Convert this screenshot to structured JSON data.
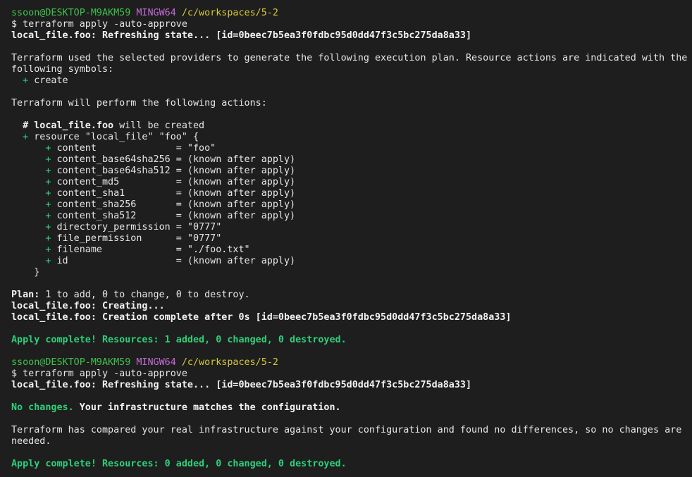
{
  "colors": {
    "background": "#1e1e1e",
    "text": "#e6e6e6",
    "prompt_user": "#3fc24d",
    "prompt_host": "#c46bd6",
    "prompt_path": "#d6c93a",
    "success_green": "#2fcf79"
  },
  "lines": [
    {
      "name": "prompt-line",
      "segments": [
        {
          "text": "ssoon@DESKTOP-M9AKM59",
          "cls": "c-prompt-user"
        },
        {
          "text": " ",
          "cls": ""
        },
        {
          "text": "MINGW64",
          "cls": "c-prompt-host"
        },
        {
          "text": " ",
          "cls": ""
        },
        {
          "text": "/c/workspaces/5-2",
          "cls": "c-prompt-path"
        }
      ]
    },
    {
      "name": "command-line",
      "segments": [
        {
          "text": "$ terraform apply -auto-approve",
          "cls": ""
        }
      ]
    },
    {
      "name": "refresh-line",
      "segments": [
        {
          "text": "local_file.foo: Refreshing state... [id=0beec7b5ea3f0fdbc95d0dd47f3c5bc275da8a33]",
          "cls": "bold c-white"
        }
      ]
    },
    {
      "name": "blank-line",
      "segments": []
    },
    {
      "name": "output-line",
      "segments": [
        {
          "text": "Terraform used the selected providers to generate the following execution plan. Resource actions are indicated with the",
          "cls": ""
        }
      ]
    },
    {
      "name": "output-line",
      "segments": [
        {
          "text": "following symbols:",
          "cls": ""
        }
      ]
    },
    {
      "name": "output-line",
      "segments": [
        {
          "text": "  ",
          "cls": ""
        },
        {
          "text": "+",
          "cls": "c-plus"
        },
        {
          "text": " create",
          "cls": ""
        }
      ]
    },
    {
      "name": "blank-line",
      "segments": []
    },
    {
      "name": "output-line",
      "segments": [
        {
          "text": "Terraform will perform the following actions:",
          "cls": ""
        }
      ]
    },
    {
      "name": "blank-line",
      "segments": []
    },
    {
      "name": "output-line",
      "segments": [
        {
          "text": "  # local_file.foo",
          "cls": "bold c-white"
        },
        {
          "text": " will be created",
          "cls": ""
        }
      ]
    },
    {
      "name": "output-line",
      "segments": [
        {
          "text": "  ",
          "cls": ""
        },
        {
          "text": "+",
          "cls": "c-plus"
        },
        {
          "text": " resource \"local_file\" \"foo\" {",
          "cls": ""
        }
      ]
    },
    {
      "name": "attribute-line",
      "segments": [
        {
          "text": "      ",
          "cls": ""
        },
        {
          "text": "+",
          "cls": "c-plus"
        },
        {
          "text": " content              = \"foo\"",
          "cls": ""
        }
      ]
    },
    {
      "name": "attribute-line",
      "segments": [
        {
          "text": "      ",
          "cls": ""
        },
        {
          "text": "+",
          "cls": "c-plus"
        },
        {
          "text": " content_base64sha256 = (known after apply)",
          "cls": ""
        }
      ]
    },
    {
      "name": "attribute-line",
      "segments": [
        {
          "text": "      ",
          "cls": ""
        },
        {
          "text": "+",
          "cls": "c-plus"
        },
        {
          "text": " content_base64sha512 = (known after apply)",
          "cls": ""
        }
      ]
    },
    {
      "name": "attribute-line",
      "segments": [
        {
          "text": "      ",
          "cls": ""
        },
        {
          "text": "+",
          "cls": "c-plus"
        },
        {
          "text": " content_md5          = (known after apply)",
          "cls": ""
        }
      ]
    },
    {
      "name": "attribute-line",
      "segments": [
        {
          "text": "      ",
          "cls": ""
        },
        {
          "text": "+",
          "cls": "c-plus"
        },
        {
          "text": " content_sha1         = (known after apply)",
          "cls": ""
        }
      ]
    },
    {
      "name": "attribute-line",
      "segments": [
        {
          "text": "      ",
          "cls": ""
        },
        {
          "text": "+",
          "cls": "c-plus"
        },
        {
          "text": " content_sha256       = (known after apply)",
          "cls": ""
        }
      ]
    },
    {
      "name": "attribute-line",
      "segments": [
        {
          "text": "      ",
          "cls": ""
        },
        {
          "text": "+",
          "cls": "c-plus"
        },
        {
          "text": " content_sha512       = (known after apply)",
          "cls": ""
        }
      ]
    },
    {
      "name": "attribute-line",
      "segments": [
        {
          "text": "      ",
          "cls": ""
        },
        {
          "text": "+",
          "cls": "c-plus"
        },
        {
          "text": " directory_permission = \"0777\"",
          "cls": ""
        }
      ]
    },
    {
      "name": "attribute-line",
      "segments": [
        {
          "text": "      ",
          "cls": ""
        },
        {
          "text": "+",
          "cls": "c-plus"
        },
        {
          "text": " file_permission      = \"0777\"",
          "cls": ""
        }
      ]
    },
    {
      "name": "attribute-line",
      "segments": [
        {
          "text": "      ",
          "cls": ""
        },
        {
          "text": "+",
          "cls": "c-plus"
        },
        {
          "text": " filename             = \"./foo.txt\"",
          "cls": ""
        }
      ]
    },
    {
      "name": "attribute-line",
      "segments": [
        {
          "text": "      ",
          "cls": ""
        },
        {
          "text": "+",
          "cls": "c-plus"
        },
        {
          "text": " id                   = (known after apply)",
          "cls": ""
        }
      ]
    },
    {
      "name": "output-line",
      "segments": [
        {
          "text": "    }",
          "cls": ""
        }
      ]
    },
    {
      "name": "blank-line",
      "segments": []
    },
    {
      "name": "plan-line",
      "segments": [
        {
          "text": "Plan:",
          "cls": "bold c-white"
        },
        {
          "text": " 1 to add, 0 to change, 0 to destroy.",
          "cls": ""
        }
      ]
    },
    {
      "name": "status-line",
      "segments": [
        {
          "text": "local_file.foo: Creating...",
          "cls": "bold c-white"
        }
      ]
    },
    {
      "name": "status-line",
      "segments": [
        {
          "text": "local_file.foo: Creation complete after 0s [id=0beec7b5ea3f0fdbc95d0dd47f3c5bc275da8a33]",
          "cls": "bold c-white"
        }
      ]
    },
    {
      "name": "blank-line",
      "segments": []
    },
    {
      "name": "apply-complete-line",
      "segments": [
        {
          "text": "Apply complete! Resources: 1 added, 0 changed, 0 destroyed.",
          "cls": "bold c-green"
        }
      ]
    },
    {
      "name": "blank-line",
      "segments": []
    },
    {
      "name": "prompt-line",
      "segments": [
        {
          "text": "ssoon@DESKTOP-M9AKM59",
          "cls": "c-prompt-user"
        },
        {
          "text": " ",
          "cls": ""
        },
        {
          "text": "MINGW64",
          "cls": "c-prompt-host"
        },
        {
          "text": " ",
          "cls": ""
        },
        {
          "text": "/c/workspaces/5-2",
          "cls": "c-prompt-path"
        }
      ]
    },
    {
      "name": "command-line",
      "segments": [
        {
          "text": "$ terraform apply -auto-approve",
          "cls": ""
        }
      ]
    },
    {
      "name": "refresh-line",
      "segments": [
        {
          "text": "local_file.foo: Refreshing state... [id=0beec7b5ea3f0fdbc95d0dd47f3c5bc275da8a33]",
          "cls": "bold c-white"
        }
      ]
    },
    {
      "name": "blank-line",
      "segments": []
    },
    {
      "name": "no-changes-line",
      "segments": [
        {
          "text": "No changes.",
          "cls": "bold c-green"
        },
        {
          "text": " Your infrastructure matches the configuration.",
          "cls": "bold c-white"
        }
      ]
    },
    {
      "name": "blank-line",
      "segments": []
    },
    {
      "name": "output-line",
      "segments": [
        {
          "text": "Terraform has compared your real infrastructure against your configuration and found no differences, so no changes are",
          "cls": ""
        }
      ]
    },
    {
      "name": "output-line",
      "segments": [
        {
          "text": "needed.",
          "cls": ""
        }
      ]
    },
    {
      "name": "blank-line",
      "segments": []
    },
    {
      "name": "apply-complete-line",
      "segments": [
        {
          "text": "Apply complete! Resources: 0 added, 0 changed, 0 destroyed.",
          "cls": "bold c-green"
        }
      ]
    }
  ]
}
